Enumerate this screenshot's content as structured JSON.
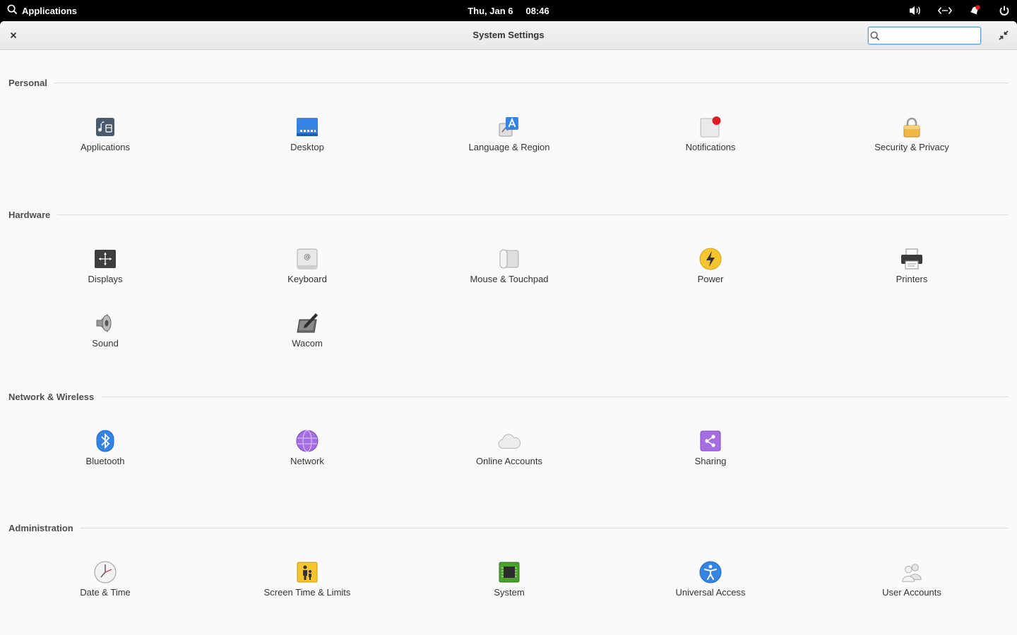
{
  "panel": {
    "applications_label": "Applications",
    "date": "Thu, Jan 6",
    "time": "08:46"
  },
  "window": {
    "title": "System Settings",
    "search_value": "",
    "search_placeholder": ""
  },
  "sections": {
    "personal": {
      "title": "Personal",
      "items": [
        "Applications",
        "Desktop",
        "Language & Region",
        "Notifications",
        "Security & Privacy"
      ]
    },
    "hardware": {
      "title": "Hardware",
      "items": [
        "Displays",
        "Keyboard",
        "Mouse & Touchpad",
        "Power",
        "Printers",
        "Sound",
        "Wacom"
      ]
    },
    "network": {
      "title": "Network & Wireless",
      "items": [
        "Bluetooth",
        "Network",
        "Online Accounts",
        "Sharing"
      ]
    },
    "admin": {
      "title": "Administration",
      "items": [
        "Date & Time",
        "Screen Time & Limits",
        "System",
        "Universal Access",
        "User Accounts"
      ]
    }
  },
  "colors": {
    "accent": "#5ea0e0",
    "notification_dot": "#e01b24",
    "panel_bg": "#000000",
    "window_bg": "#fafafa"
  }
}
